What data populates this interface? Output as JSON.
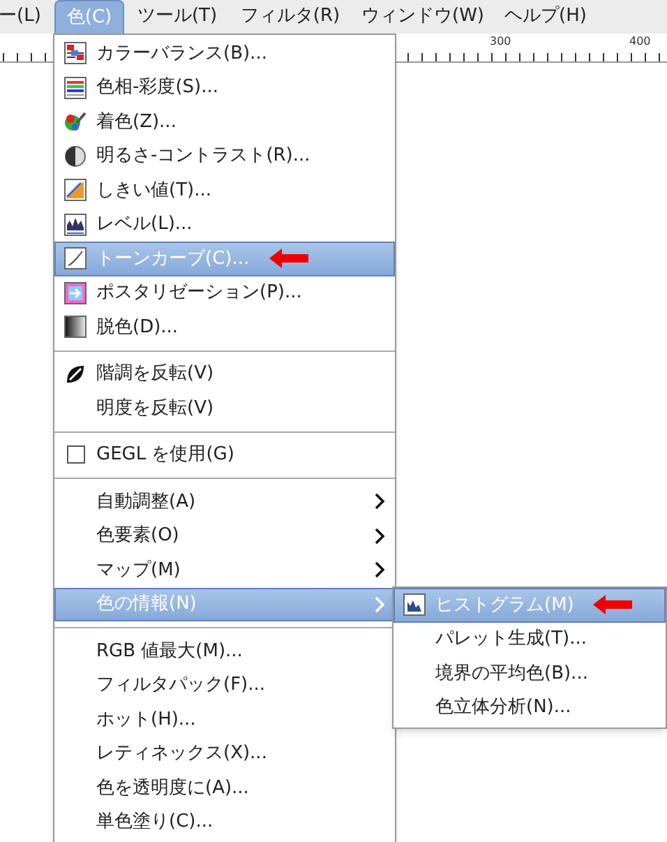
{
  "menubar": [
    {
      "label": "ー(L)",
      "selected": false
    },
    {
      "label": "色(C)",
      "selected": true
    },
    {
      "label": "ツール(T)",
      "selected": false
    },
    {
      "label": "フィルタ(R)",
      "selected": false
    },
    {
      "label": "ウィンドウ(W)",
      "selected": false
    },
    {
      "label": "ヘルプ(H)",
      "selected": false
    }
  ],
  "ruler": {
    "labels": [
      "300",
      "400"
    ]
  },
  "menu": {
    "sections": [
      [
        {
          "label": "カラーバランス(B)...",
          "kind": "action",
          "selected": false,
          "arrow": false
        },
        {
          "label": "色相-彩度(S)...",
          "kind": "action",
          "selected": false,
          "arrow": false
        },
        {
          "label": "着色(Z)...",
          "kind": "action",
          "selected": false,
          "arrow": false
        },
        {
          "label": "明るさ-コントラスト(R)...",
          "kind": "action",
          "selected": false,
          "arrow": false
        },
        {
          "label": "しきい値(T)...",
          "kind": "action",
          "selected": false,
          "arrow": false
        },
        {
          "label": "レベル(L)...",
          "kind": "action",
          "selected": false,
          "arrow": false
        },
        {
          "label": "トーンカーブ(C)...",
          "kind": "action",
          "selected": true,
          "arrow": true
        },
        {
          "label": "ポスタリゼーション(P)...",
          "kind": "action",
          "selected": false,
          "arrow": false
        },
        {
          "label": "脱色(D)...",
          "kind": "action",
          "selected": false,
          "arrow": false
        }
      ],
      [
        {
          "label": "階調を反転(V)",
          "kind": "action",
          "selected": false,
          "arrow": false
        },
        {
          "label": "明度を反転(V)",
          "kind": "action",
          "selected": false,
          "arrow": false
        }
      ],
      [
        {
          "label": "GEGL を使用(G)",
          "kind": "check",
          "checked": false,
          "selected": false,
          "arrow": false
        }
      ],
      [
        {
          "label": "自動調整(A)",
          "kind": "submenu",
          "selected": false,
          "arrow": false
        },
        {
          "label": "色要素(O)",
          "kind": "submenu",
          "selected": false,
          "arrow": false
        },
        {
          "label": "マップ(M)",
          "kind": "submenu",
          "selected": false,
          "arrow": false
        },
        {
          "label": "色の情報(N)",
          "kind": "submenu",
          "selected": true,
          "arrow": false
        }
      ],
      [
        {
          "label": "RGB 値最大(M)...",
          "kind": "action",
          "selected": false,
          "arrow": false
        },
        {
          "label": "フィルタパック(F)...",
          "kind": "action",
          "selected": false,
          "arrow": false
        },
        {
          "label": "ホット(H)...",
          "kind": "action",
          "selected": false,
          "arrow": false
        },
        {
          "label": "レティネックス(X)...",
          "kind": "action",
          "selected": false,
          "arrow": false
        },
        {
          "label": "色を透明度に(A)...",
          "kind": "action",
          "selected": false,
          "arrow": false
        },
        {
          "label": "単色塗り(C)...",
          "kind": "action",
          "selected": false,
          "arrow": false
        }
      ]
    ]
  },
  "submenu": {
    "items": [
      {
        "label": "ヒストグラム(M)",
        "selected": true,
        "arrow": true
      },
      {
        "label": "パレット生成(T)...",
        "selected": false,
        "arrow": false
      },
      {
        "label": "境界の平均色(B)...",
        "selected": false,
        "arrow": false
      },
      {
        "label": "色立体分析(N)...",
        "selected": false,
        "arrow": false
      }
    ]
  }
}
